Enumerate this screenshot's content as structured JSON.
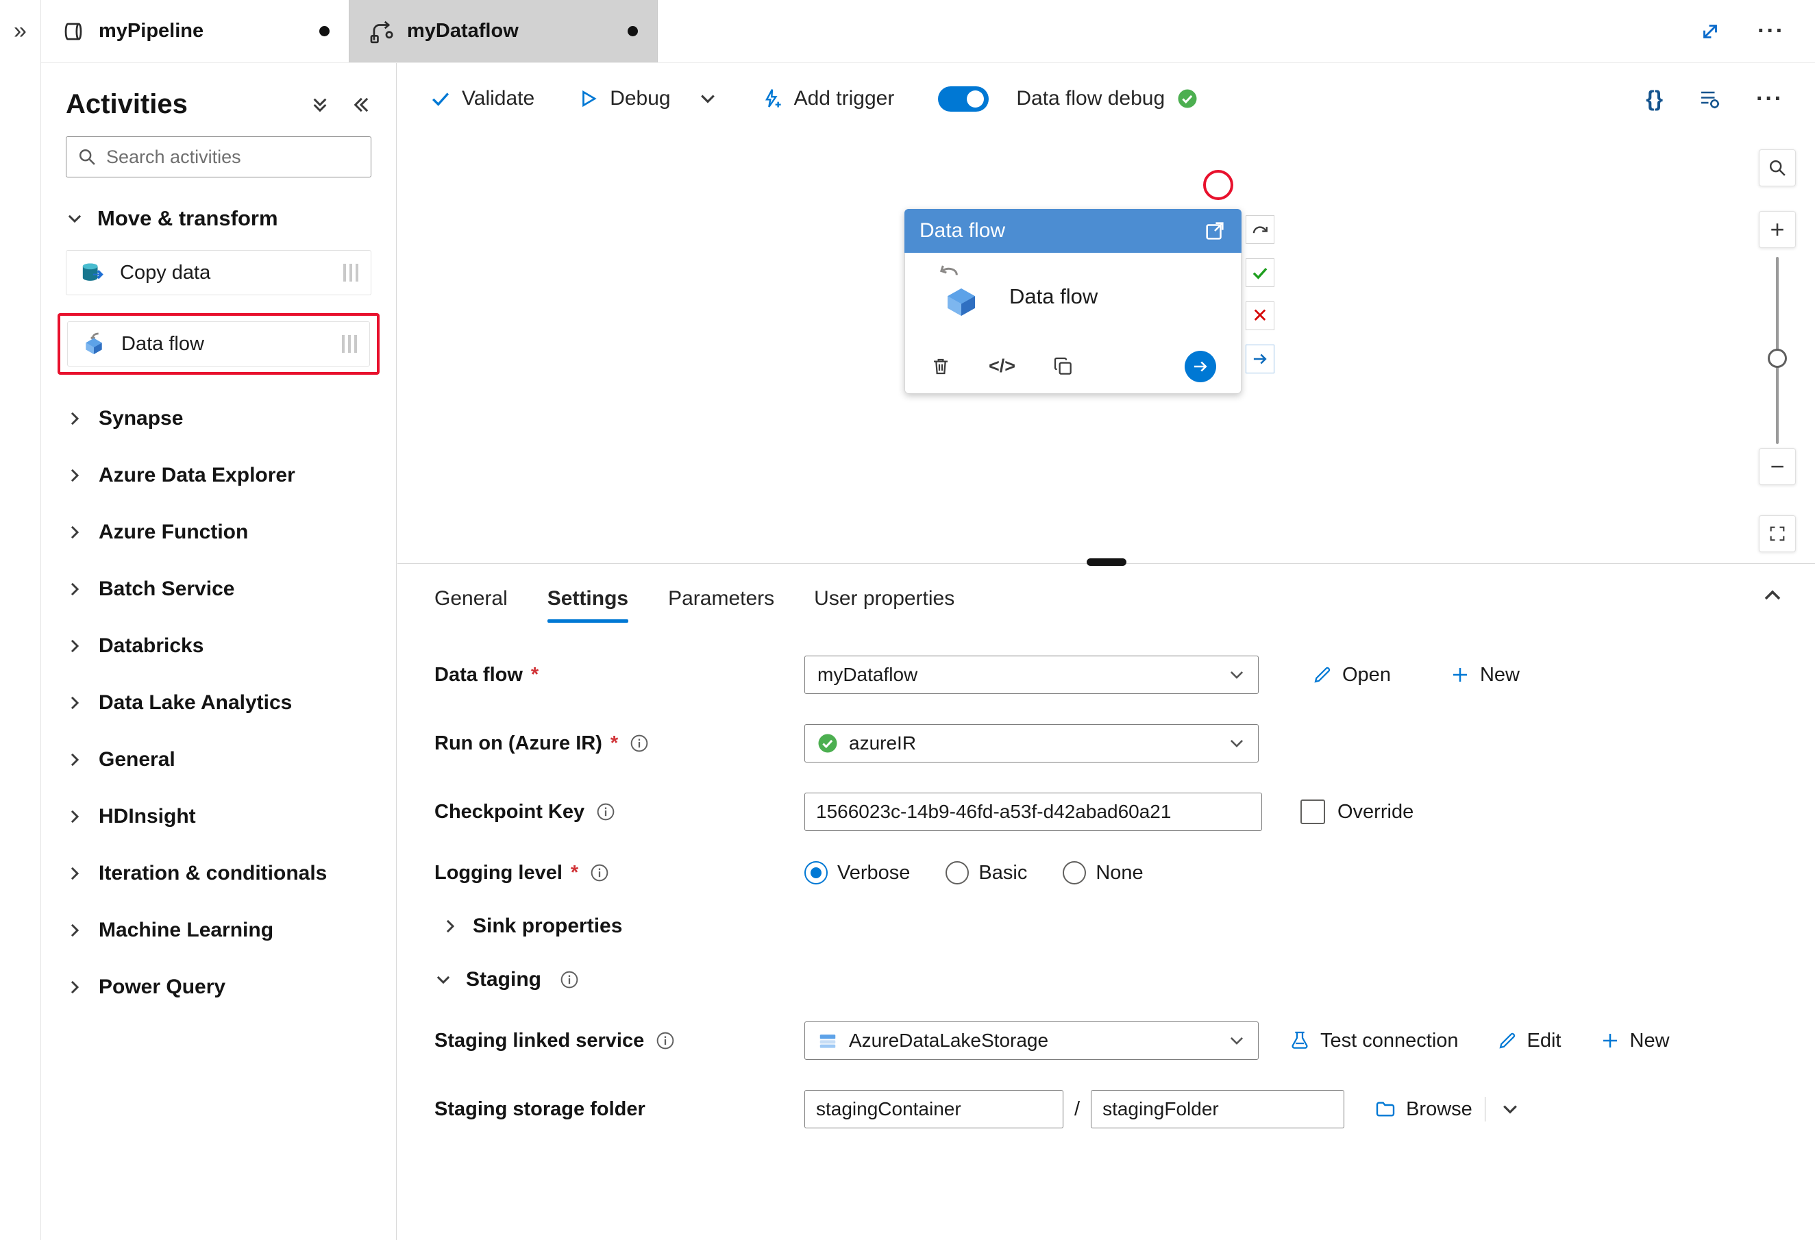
{
  "colors": {
    "accent_blue": "#0078d4",
    "node_header_blue": "#4c8dd2",
    "highlight_red": "#e8112d",
    "status_green": "#4caf50",
    "inactive_tab_gray": "#d2d2d2"
  },
  "window": {
    "collapse_rail_icon": "»",
    "more_icon": "···"
  },
  "tabs": [
    {
      "label": "myPipeline"
    },
    {
      "label": "myDataflow"
    }
  ],
  "sidebar": {
    "title": "Activities",
    "search_placeholder": "Search activities",
    "expanded_section": {
      "label": "Move & transform"
    },
    "activity_items": [
      {
        "label": "Copy data"
      },
      {
        "label": "Data flow"
      }
    ],
    "collapsed_sections": [
      {
        "label": "Synapse"
      },
      {
        "label": "Azure Data Explorer"
      },
      {
        "label": "Azure Function"
      },
      {
        "label": "Batch Service"
      },
      {
        "label": "Databricks"
      },
      {
        "label": "Data Lake Analytics"
      },
      {
        "label": "General"
      },
      {
        "label": "HDInsight"
      },
      {
        "label": "Iteration & conditionals"
      },
      {
        "label": "Machine Learning"
      },
      {
        "label": "Power Query"
      }
    ]
  },
  "toolbar": {
    "validate": "Validate",
    "debug": "Debug",
    "add_trigger": "Add trigger",
    "dataflow_debug": "Data flow debug",
    "code_icon": "{}"
  },
  "canvas": {
    "node": {
      "title": "Data flow",
      "name": "Data flow",
      "code_icon": "</>"
    }
  },
  "panel": {
    "tabs": [
      {
        "label": "General"
      },
      {
        "label": "Settings"
      },
      {
        "label": "Parameters"
      },
      {
        "label": "User properties"
      }
    ],
    "active_tab": "Settings",
    "fields": {
      "data_flow": {
        "label": "Data flow",
        "value": "myDataflow",
        "open_label": "Open",
        "new_label": "New"
      },
      "run_on": {
        "label": "Run on (Azure IR)",
        "value": "azureIR"
      },
      "checkpoint_key": {
        "label": "Checkpoint Key",
        "value": "1566023c-14b9-46fd-a53f-d42abad60a21",
        "override_label": "Override"
      },
      "logging_level": {
        "label": "Logging level",
        "selected": "Verbose",
        "options": [
          {
            "label": "Verbose"
          },
          {
            "label": "Basic"
          },
          {
            "label": "None"
          }
        ]
      },
      "sink_properties": {
        "label": "Sink properties"
      },
      "staging": {
        "label": "Staging"
      },
      "staging_linked_service": {
        "label": "Staging linked service",
        "value": "AzureDataLakeStorage",
        "test_label": "Test connection",
        "edit_label": "Edit",
        "new_label": "New"
      },
      "staging_storage_folder": {
        "label": "Staging storage folder",
        "container_value": "stagingContainer",
        "separator": "/",
        "folder_value": "stagingFolder",
        "browse_label": "Browse"
      }
    }
  }
}
